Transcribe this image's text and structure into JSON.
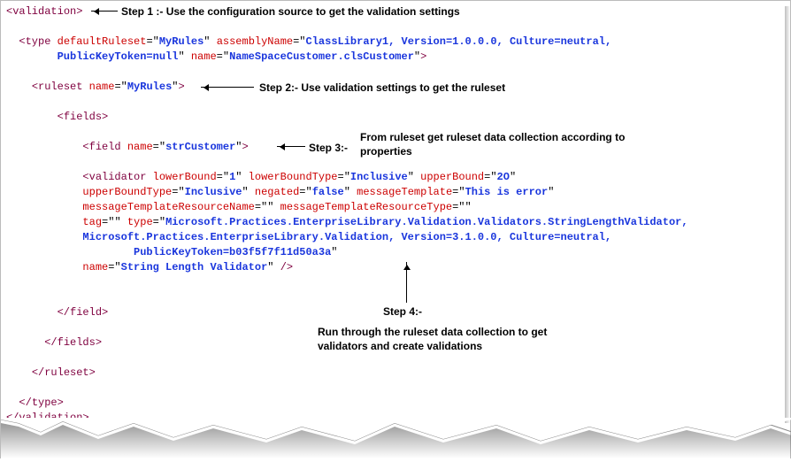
{
  "annotations": {
    "step1_label": "Step 1 :-",
    "step1_text": "Use the configuration source to get the validation settings",
    "step2_label": "Step 2:-",
    "step2_text": "Use validation settings to get the ruleset",
    "step3_label": "Step 3:-",
    "step3_text_line1": "From ruleset get ruleset data collection according to",
    "step3_text_line2": "properties",
    "step4_label": "Step 4:-",
    "step4_text_line1": "Run through the ruleset data collection to get",
    "step4_text_line2": "validators and create validations"
  },
  "xml": {
    "root_open": "validation",
    "root_close": "validation",
    "type": {
      "tag": "type",
      "attrs": {
        "defaultRuleset_name": "defaultRuleset",
        "defaultRuleset_value": "MyRules",
        "assemblyName_name": "assemblyName",
        "assemblyName_value_part1": "ClassLibrary1, Version=1.0.0.0, Culture=neutral,",
        "assemblyName_value_part2": "PublicKeyToken=null",
        "name_name": "name",
        "name_value": "NameSpaceCustomer.clsCustomer"
      },
      "close": "type"
    },
    "ruleset": {
      "tag": "ruleset",
      "name_name": "name",
      "name_value": "MyRules",
      "close": "ruleset"
    },
    "fields_open": "fields",
    "fields_close": "fields",
    "field": {
      "tag": "field",
      "name_name": "name",
      "name_value": "strCustomer",
      "close": "field"
    },
    "validator": {
      "tag": "validator",
      "lowerBound_n": "lowerBound",
      "lowerBound_v": "1",
      "lowerBoundType_n": "lowerBoundType",
      "lowerBoundType_v": "Inclusive",
      "upperBound_n": "upperBound",
      "upperBound_v": "2O",
      "upperBoundType_n": "upperBoundType",
      "upperBoundType_v": "Inclusive",
      "negated_n": "negated",
      "negated_v": "false",
      "messageTemplate_n": "messageTemplate",
      "messageTemplate_v": "This is error",
      "messageTemplateResourceName_n": "messageTemplateResourceName",
      "messageTemplateResourceName_v": "",
      "messageTemplateResourceType_n": "messageTemplateResourceType",
      "messageTemplateResourceType_v": "",
      "tag_n": "tag",
      "tag_v": "",
      "type_n": "type",
      "type_v_l1": "Microsoft.Practices.EnterpriseLibrary.Validation.Validators.StringLengthValidator,",
      "type_v_l2": "Microsoft.Practices.EnterpriseLibrary.Validation, Version=3.1.0.0, Culture=neutral,",
      "type_v_l3": "PublicKeyToken=b03f5f7f11d50a3a",
      "name_n": "name",
      "name_v": "String Length Validator"
    }
  }
}
